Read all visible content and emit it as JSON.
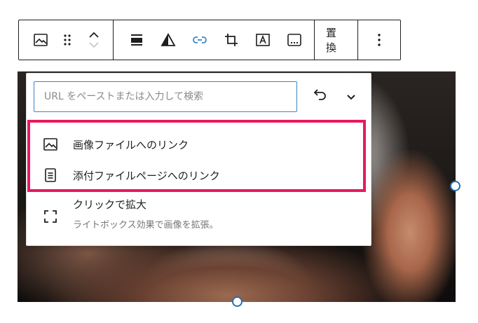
{
  "toolbar": {
    "replace_label": "置換",
    "icons": [
      "image-icon",
      "drag-handle-icon",
      "move-up-icon",
      "move-down-icon",
      "align-icon",
      "duotone-icon",
      "link-icon",
      "crop-icon",
      "text-overlay-icon",
      "caption-icon",
      "more-options-icon"
    ]
  },
  "link_popover": {
    "url_placeholder": "URL をペーストまたは入力して検索",
    "url_value": "",
    "options": [
      {
        "label": "画像ファイルへのリンク",
        "icon": "image-icon"
      },
      {
        "label": "添付ファイルページへのリンク",
        "icon": "page-icon"
      },
      {
        "label": "クリックで拡大",
        "description": "ライトボックス効果で画像を拡張。",
        "icon": "fullscreen-icon"
      }
    ]
  },
  "colors": {
    "accent": "#3a86c4",
    "highlight": "#e8195f",
    "handle": "#2b6cb0"
  }
}
